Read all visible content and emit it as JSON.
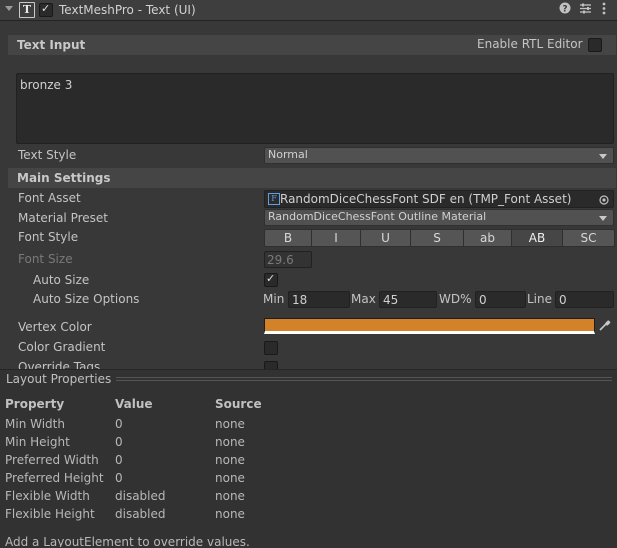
{
  "header": {
    "title": "TextMeshPro - Text (UI)"
  },
  "text_input": {
    "section_label": "Text Input",
    "rtl_label": "Enable RTL Editor",
    "value": "bronze 3",
    "style_label": "Text Style",
    "style_value": "Normal"
  },
  "main": {
    "section_label": "Main Settings",
    "font_asset_label": "Font Asset",
    "font_asset_value": "RandomDiceChessFont SDF en (TMP_Font Asset)",
    "material_label": "Material Preset",
    "material_value": "RandomDiceChessFont Outline Material",
    "font_style_label": "Font Style",
    "font_style_buttons": [
      "B",
      "I",
      "U",
      "S",
      "ab",
      "AB",
      "SC"
    ],
    "font_size_label": "Font Size",
    "font_size_value": "29.6",
    "auto_size_label": "Auto Size",
    "auto_size_options_label": "Auto Size Options",
    "min_label": "Min",
    "min_value": "18",
    "max_label": "Max",
    "max_value": "45",
    "wd_label": "WD%",
    "wd_value": "0",
    "line_label": "Line",
    "line_value": "0",
    "vertex_color_label": "Vertex Color",
    "vertex_color": "#d4822a",
    "color_gradient_label": "Color Gradient",
    "override_tags_label": "Override Tags"
  },
  "layout": {
    "title": "Layout Properties",
    "headers": [
      "Property",
      "Value",
      "Source"
    ],
    "rows": [
      [
        "Min Width",
        "0",
        "none"
      ],
      [
        "Min Height",
        "0",
        "none"
      ],
      [
        "Preferred Width",
        "0",
        "none"
      ],
      [
        "Preferred Height",
        "0",
        "none"
      ],
      [
        "Flexible Width",
        "disabled",
        "none"
      ],
      [
        "Flexible Height",
        "disabled",
        "none"
      ]
    ],
    "footer": "Add a LayoutElement to override values."
  }
}
